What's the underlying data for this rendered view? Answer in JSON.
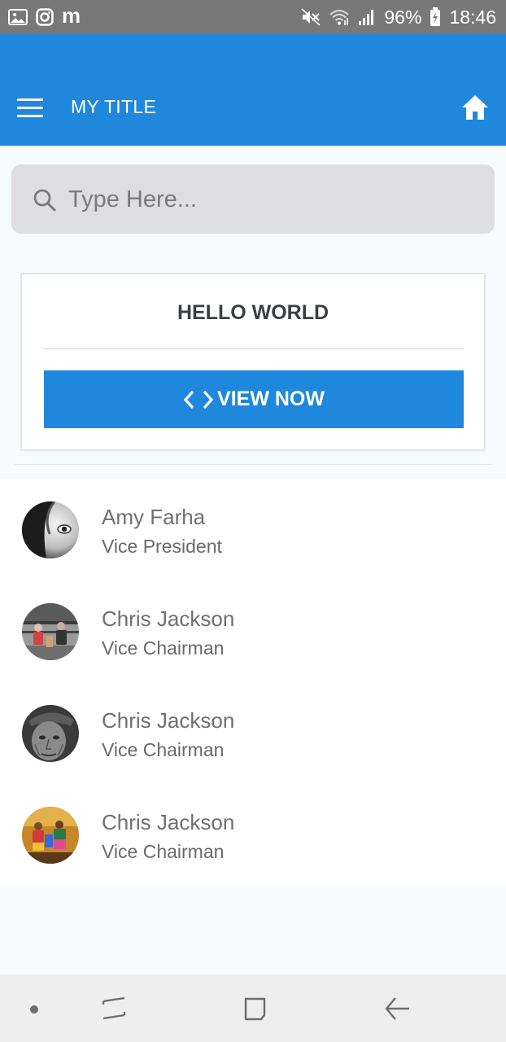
{
  "status_bar": {
    "battery": "96%",
    "time": "18:46",
    "left_icons": [
      "gallery-icon",
      "instagram-icon",
      "m-app-icon"
    ],
    "m_glyph": "m",
    "right_icons": [
      "mute-icon",
      "wifi-icon",
      "signal-icon",
      "battery-icon"
    ]
  },
  "app_bar": {
    "title": "MY TITLE",
    "color": "#2088dc",
    "menu_icon": "hamburger-menu-icon",
    "home_icon": "home-icon"
  },
  "search": {
    "placeholder": "Type Here...",
    "value": ""
  },
  "card": {
    "title": "HELLO WORLD",
    "button_label": "VIEW NOW",
    "button_icon": "code-icon"
  },
  "list": {
    "items": [
      {
        "name": "Amy Farha",
        "role": "Vice President"
      },
      {
        "name": "Chris Jackson",
        "role": "Vice Chairman"
      },
      {
        "name": "Chris Jackson",
        "role": "Vice Chairman"
      },
      {
        "name": "Chris Jackson",
        "role": "Vice Chairman"
      }
    ]
  },
  "nav_bar": {
    "buttons": [
      "recent-apps-icon",
      "home-square-icon",
      "back-icon"
    ]
  }
}
